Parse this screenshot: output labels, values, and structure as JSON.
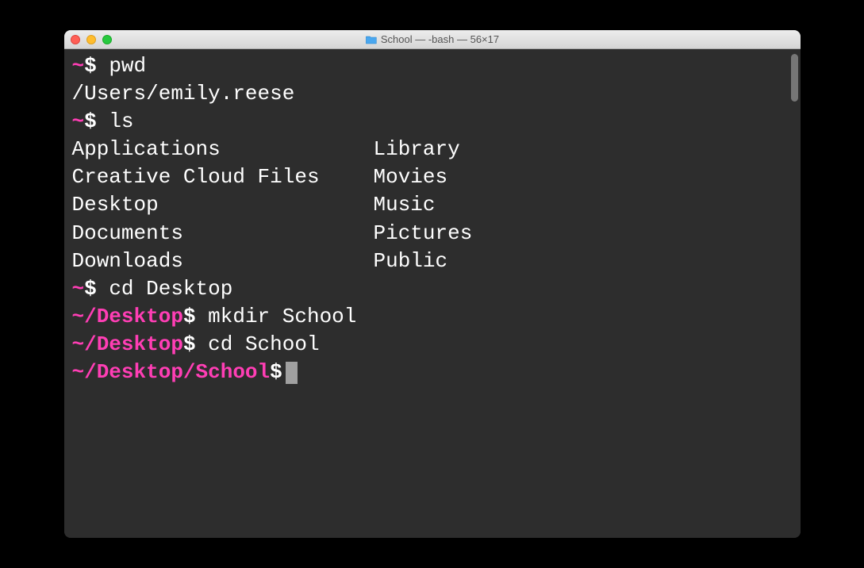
{
  "title_bar": {
    "title_text": "School — -bash — 56×17"
  },
  "lines": {
    "l1": {
      "prompt_path": "~",
      "dollar": "$",
      "cmd": " pwd"
    },
    "l2": {
      "output": "/Users/emily.reese"
    },
    "l3": {
      "prompt_path": "~",
      "dollar": "$",
      "cmd": " ls"
    },
    "ls_col1": {
      "r0": "Applications",
      "r1": "Creative Cloud Files",
      "r2": "Desktop",
      "r3": "Documents",
      "r4": "Downloads"
    },
    "ls_col2": {
      "r0": "Library",
      "r1": "Movies",
      "r2": "Music",
      "r3": "Pictures",
      "r4": "Public"
    },
    "l5": {
      "prompt_path": "~",
      "dollar": "$",
      "cmd": " cd Desktop"
    },
    "l6": {
      "prompt_path": "~/Desktop",
      "dollar": "$",
      "cmd": " mkdir School"
    },
    "l7": {
      "prompt_path": "~/Desktop",
      "dollar": "$",
      "cmd": " cd School"
    },
    "l8": {
      "prompt_path": "~/Desktop/School",
      "dollar": "$",
      "cmd": " "
    }
  }
}
